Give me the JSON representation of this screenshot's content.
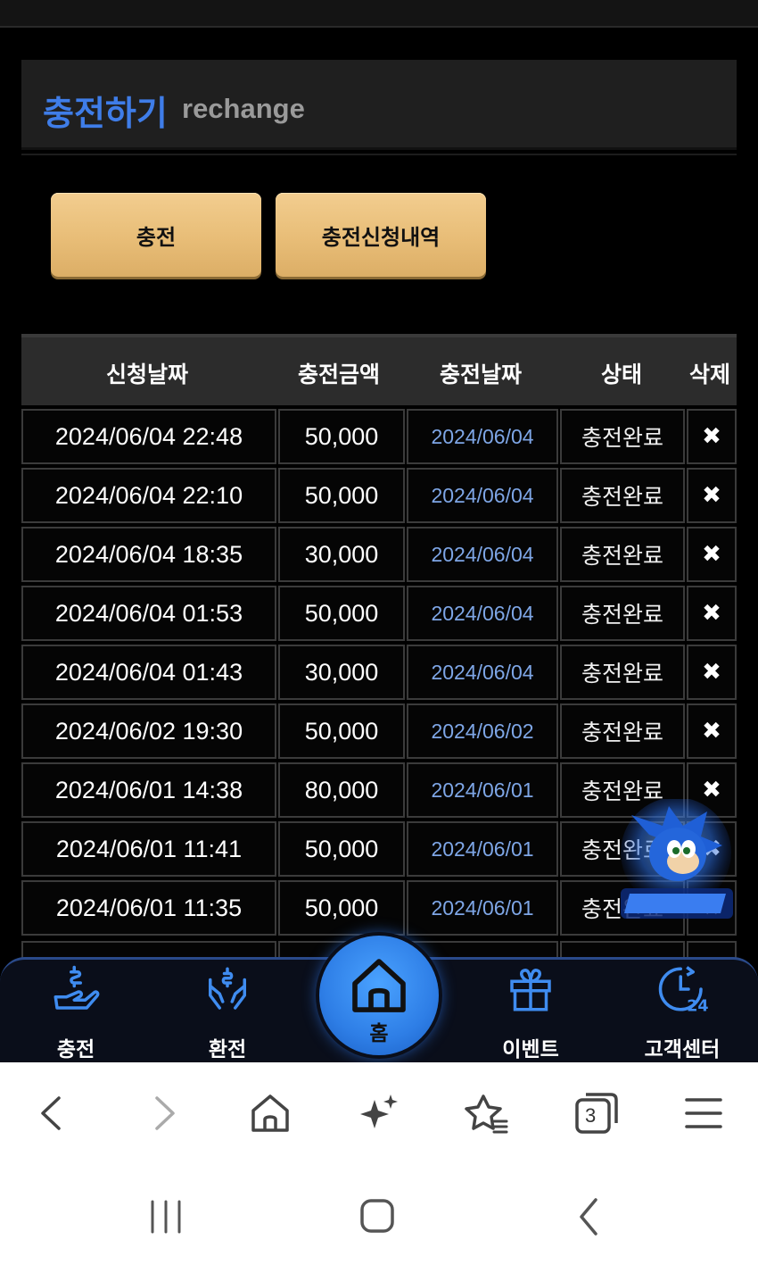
{
  "header": {
    "title": "충전하기",
    "subtitle": "rechange"
  },
  "buttons": {
    "charge": "충전",
    "history": "충전신청내역"
  },
  "table": {
    "columns": [
      "신청날짜",
      "충전금액",
      "충전날짜",
      "상태",
      "삭제"
    ],
    "rows": [
      {
        "request_date": "2024/06/04 22:48",
        "amount": "50,000",
        "charge_date": "2024/06/04",
        "status": "충전완료",
        "delete": "✖"
      },
      {
        "request_date": "2024/06/04 22:10",
        "amount": "50,000",
        "charge_date": "2024/06/04",
        "status": "충전완료",
        "delete": "✖"
      },
      {
        "request_date": "2024/06/04 18:35",
        "amount": "30,000",
        "charge_date": "2024/06/04",
        "status": "충전완료",
        "delete": "✖"
      },
      {
        "request_date": "2024/06/04 01:53",
        "amount": "50,000",
        "charge_date": "2024/06/04",
        "status": "충전완료",
        "delete": "✖"
      },
      {
        "request_date": "2024/06/04 01:43",
        "amount": "30,000",
        "charge_date": "2024/06/04",
        "status": "충전완료",
        "delete": "✖"
      },
      {
        "request_date": "2024/06/02 19:30",
        "amount": "50,000",
        "charge_date": "2024/06/02",
        "status": "충전완료",
        "delete": "✖"
      },
      {
        "request_date": "2024/06/01 14:38",
        "amount": "80,000",
        "charge_date": "2024/06/01",
        "status": "충전완료",
        "delete": "✖"
      },
      {
        "request_date": "2024/06/01 11:41",
        "amount": "50,000",
        "charge_date": "2024/06/01",
        "status": "충전완료",
        "delete": "✖"
      },
      {
        "request_date": "2024/06/01 11:35",
        "amount": "50,000",
        "charge_date": "2024/06/01",
        "status": "충전완료",
        "delete": "✖"
      }
    ]
  },
  "bottom_nav": {
    "charge": "충전",
    "exchange": "환전",
    "home": "홈",
    "event": "이벤트",
    "support": "고객센터"
  },
  "browser": {
    "tab_count": "3"
  },
  "colors": {
    "accent_blue": "#3f7de8",
    "gold_button": "#e8bd77",
    "date_blue": "#7ea6e6"
  }
}
